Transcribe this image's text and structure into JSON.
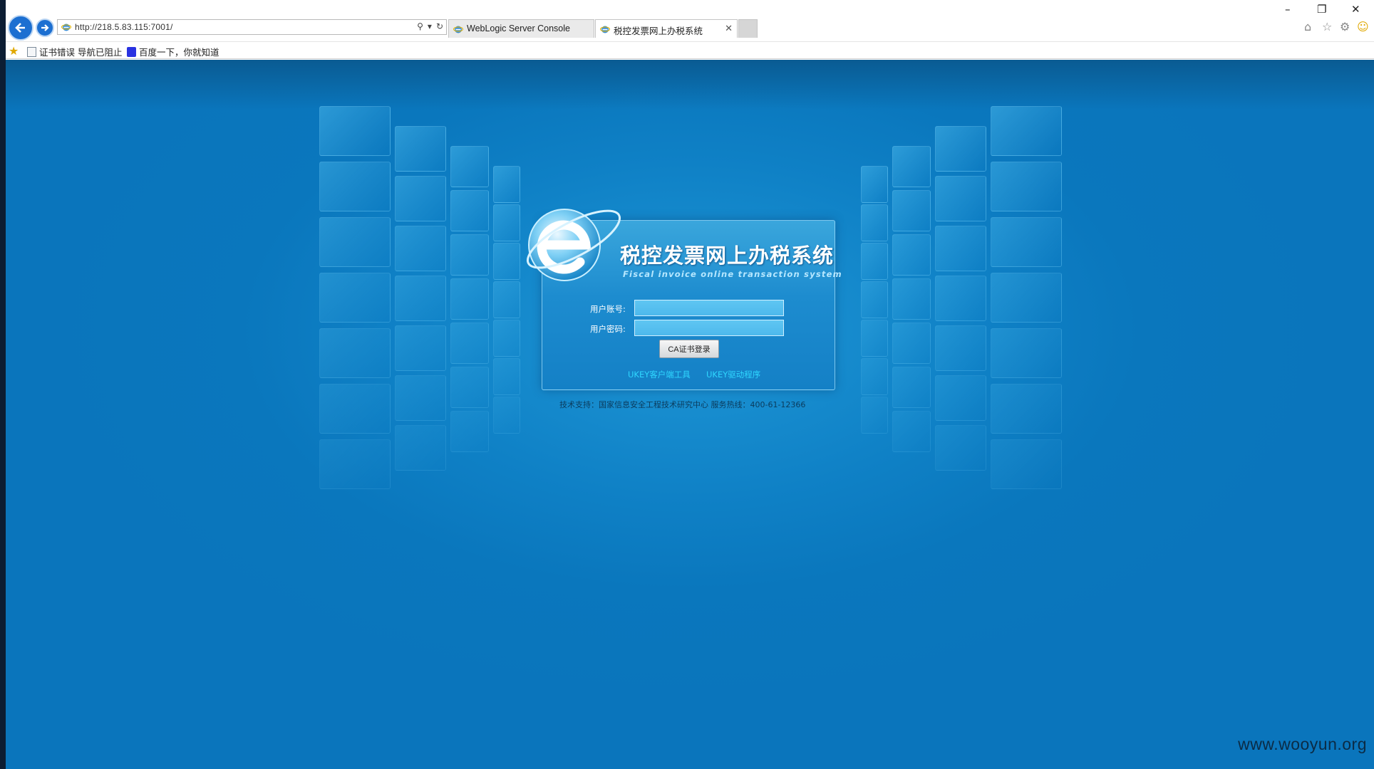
{
  "browser": {
    "url": "http://218.5.83.115:7001/",
    "tabs": [
      {
        "label": "WebLogic Server Console",
        "active": false
      },
      {
        "label": "税控发票网上办税系统",
        "active": true
      }
    ],
    "favorites": [
      {
        "label": "证书错误 导航已阻止",
        "icon": "ie-page-icon"
      },
      {
        "label": "百度一下，你就知道",
        "icon": "baidu-icon"
      }
    ],
    "window_controls": {
      "minimize": "–",
      "restore": "❐",
      "close": "✕"
    }
  },
  "login": {
    "title": "税控发票网上办税系统",
    "subtitle": "Fiscal invoice online transaction system",
    "username_label": "用户账号:",
    "password_label": "用户密码:",
    "username_value": "",
    "password_value": "",
    "login_button": "CA证书登录",
    "link_ukey_client": "UKEY客户端工具",
    "link_ukey_driver": "UKEY驱动程序"
  },
  "footer": "技术支持：国家信息安全工程技术研究中心 服务热线：400-61-12366",
  "watermark": "www.wooyun.org",
  "colors": {
    "page_bg": "#0a77bd",
    "panel": "#1d8ccf",
    "link": "#2fd7ff",
    "accent_blue": "#1c6fd1"
  }
}
